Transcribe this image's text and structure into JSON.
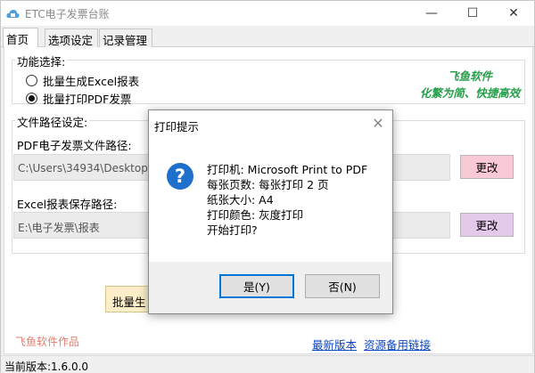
{
  "window": {
    "title": "ETC电子发票台账",
    "minimize": "—",
    "maximize": "☐",
    "close": "✕"
  },
  "tabs": [
    {
      "label": "首页",
      "active": true
    },
    {
      "label": "选项设定",
      "active": false
    },
    {
      "label": "记录管理",
      "active": false
    }
  ],
  "function_group": {
    "label": "功能选择:",
    "options": [
      {
        "label": "批量生成Excel报表",
        "selected": false
      },
      {
        "label": "批量打印PDF发票",
        "selected": true
      }
    ]
  },
  "brand": {
    "line1": "飞鱼软件",
    "line2": "化繁为简、快捷高效",
    "color": "#27a04b"
  },
  "path_group": {
    "label": "文件路径设定:",
    "pdf_label": "PDF电子发票文件路径:",
    "pdf_value": "C:\\Users\\34934\\Desktop",
    "pdf_change": "更改",
    "excel_label": "Excel报表保存路径:",
    "excel_value": "E:\\电子发票\\报表",
    "excel_change": "更改"
  },
  "action_button_partial": "批量生",
  "links": {
    "latest": "最新版本",
    "mirror": "资源备用链接"
  },
  "footer_brand": "飞鱼软件作品",
  "status": "当前版本:1.6.0.0",
  "dialog": {
    "title": "打印提示",
    "close": "✕",
    "icon": "?",
    "lines": [
      "打印机: Microsoft Print to PDF",
      "每张页数: 每张打印 2 页",
      "纸张大小: A4",
      "打印颜色: 灰度打印",
      "开始打印?"
    ],
    "yes": "是(Y)",
    "no": "否(N)"
  },
  "colors": {
    "pdf_change_bg": "#f9c9d6",
    "excel_change_bg": "#e3c9ea",
    "dialog_default_border": "#0078d7",
    "question_icon": "#1f6fcc"
  }
}
